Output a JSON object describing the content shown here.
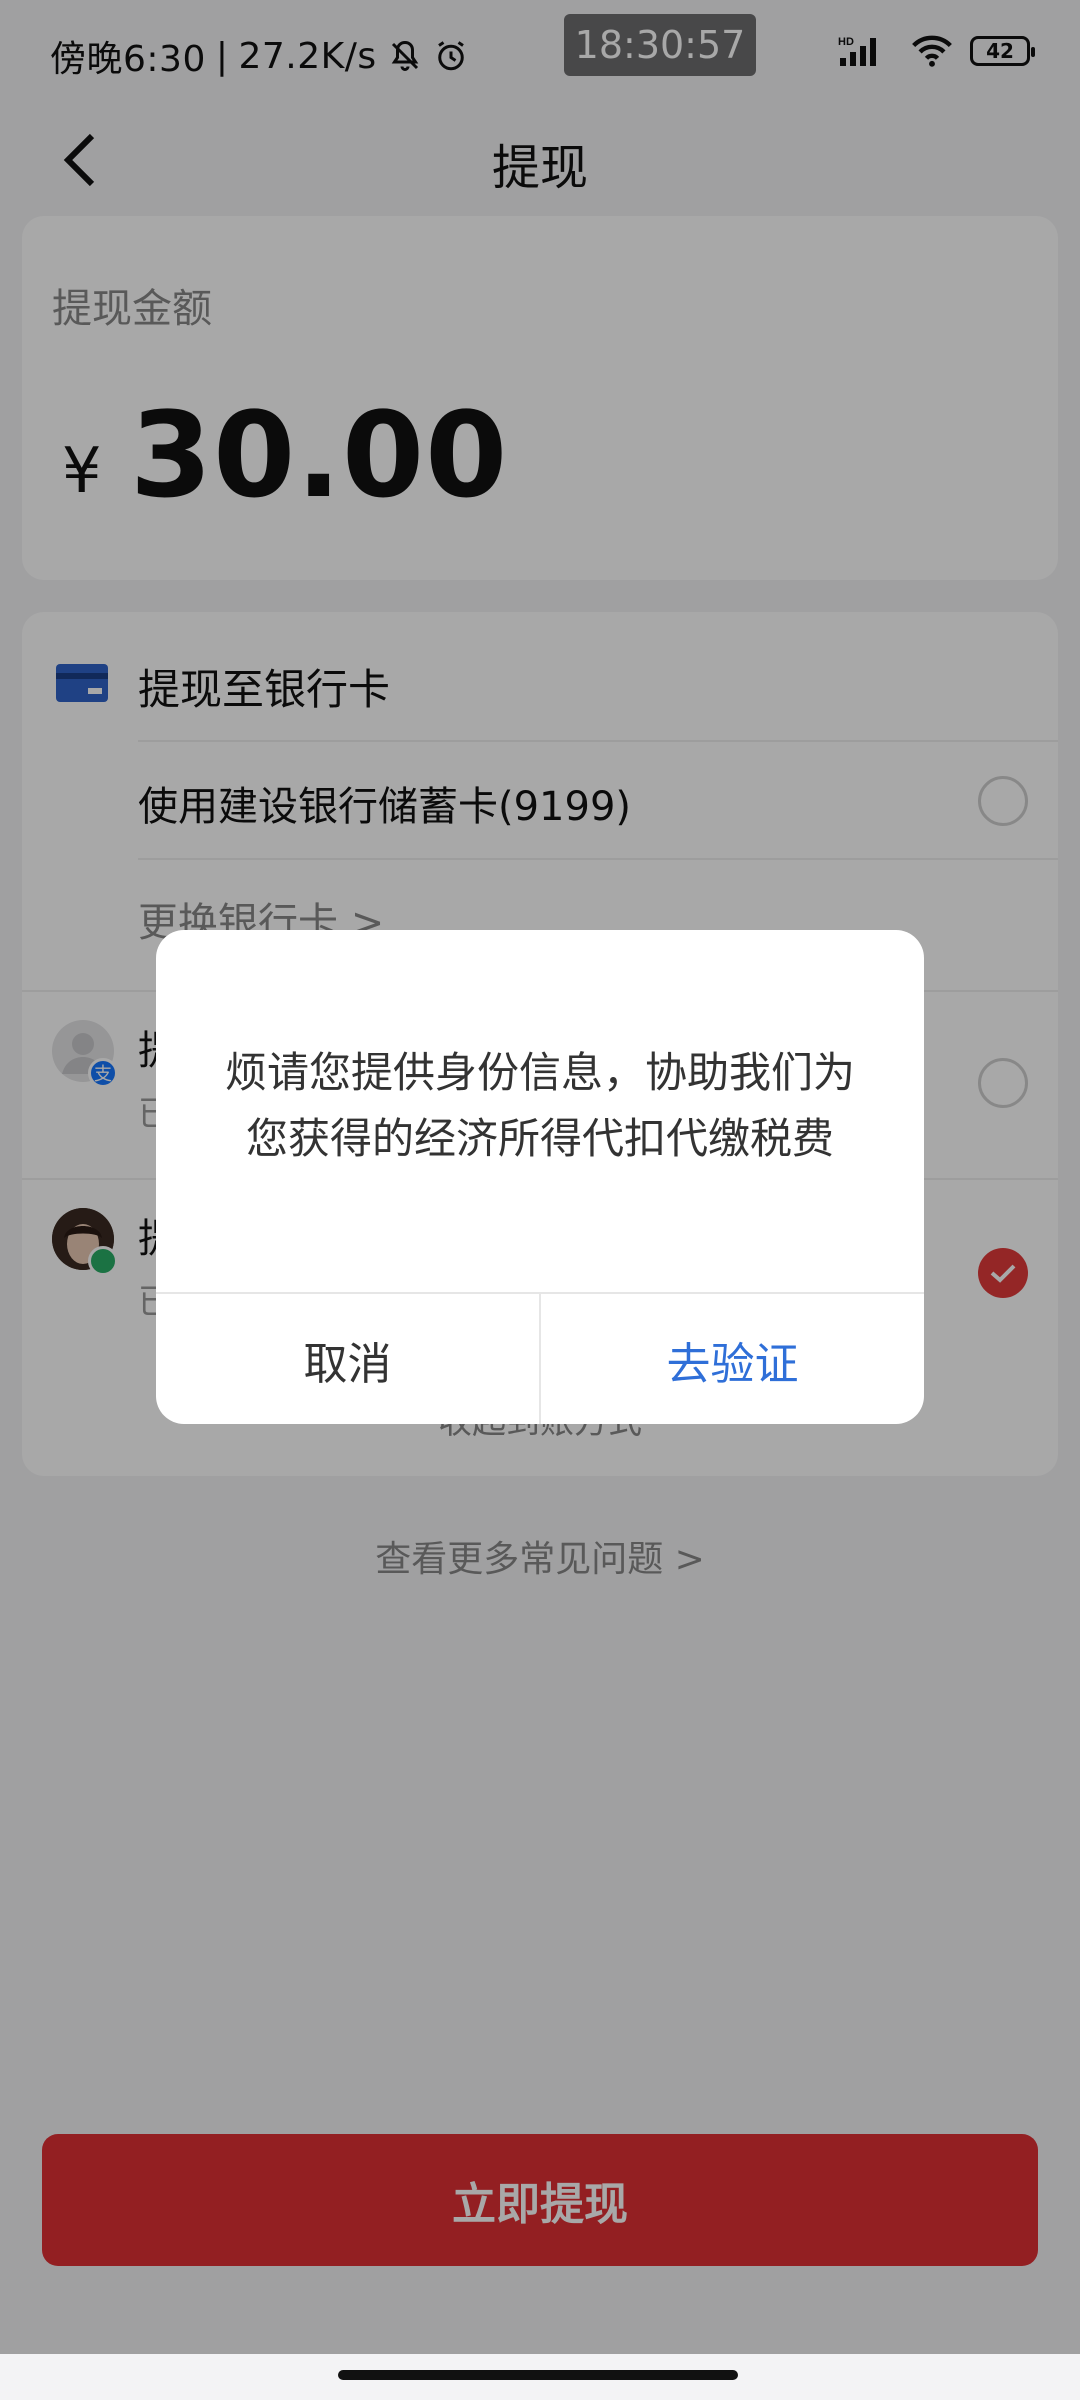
{
  "status_bar": {
    "left_text": "傍晚6:30",
    "network_speed": "27.2K/s",
    "center_time": "18:30:57",
    "signal_label": "HD",
    "battery": "42"
  },
  "nav": {
    "title": "提现"
  },
  "amount_card": {
    "label": "提现金额",
    "currency": "¥",
    "amount": "30.00"
  },
  "method_card": {
    "bank_title": "提现至银行卡",
    "bank_option": "使用建设银行储蓄卡(9199)",
    "change_card": "更换银行卡 >",
    "alipay_title": "提",
    "alipay_sub": "已",
    "wechat_title": "提",
    "wechat_sub": "已",
    "other_methods": "收起到账方式"
  },
  "faq_link": "查看更多常见问题 >",
  "withdraw_button": "立即提现",
  "dialog": {
    "message": "烦请您提供身份信息，协助我们为您获得的经济所得代扣代缴税费",
    "cancel": "取消",
    "confirm": "去验证"
  },
  "colors": {
    "accent_red": "#e02f35",
    "dialog_confirm_blue": "#2f6fd8",
    "check_red": "#e13a3a"
  }
}
